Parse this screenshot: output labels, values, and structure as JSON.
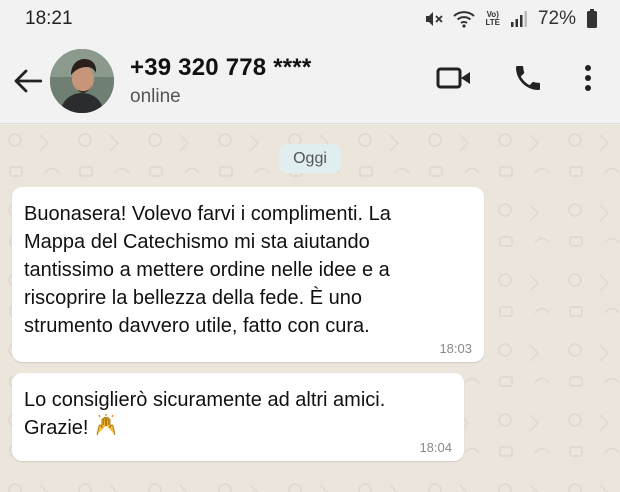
{
  "status_bar": {
    "time": "18:21",
    "lte_top": "Vo)",
    "lte_bottom": "LTE",
    "battery": "72%"
  },
  "header": {
    "contact_name": "+39 320 778 ****",
    "contact_status": "online",
    "icons": [
      "back-arrow-icon",
      "video-call-icon",
      "phone-icon",
      "more-vert-icon"
    ]
  },
  "chat": {
    "date_chip": "Oggi",
    "messages": [
      {
        "text": "Buonasera! Volevo farvi i complimenti. La\nMappa del Catechismo mi sta aiutando\ntantissimo a mettere ordine nelle idee e a\nriscoprire la bellezza della fede. È uno\nstrumento davvero utile, fatto con cura.",
        "time": "18:03"
      },
      {
        "text": "Lo consiglierò sicuramente ad altri amici.\nGrazie!",
        "time": "18:04",
        "emoji": "raising-hands-emoji"
      }
    ]
  },
  "colors": {
    "header_bg": "#f2f2f2",
    "chat_bg": "#ece5dc",
    "bubble_bg": "#ffffff",
    "date_chip_bg": "#e1eef0"
  }
}
